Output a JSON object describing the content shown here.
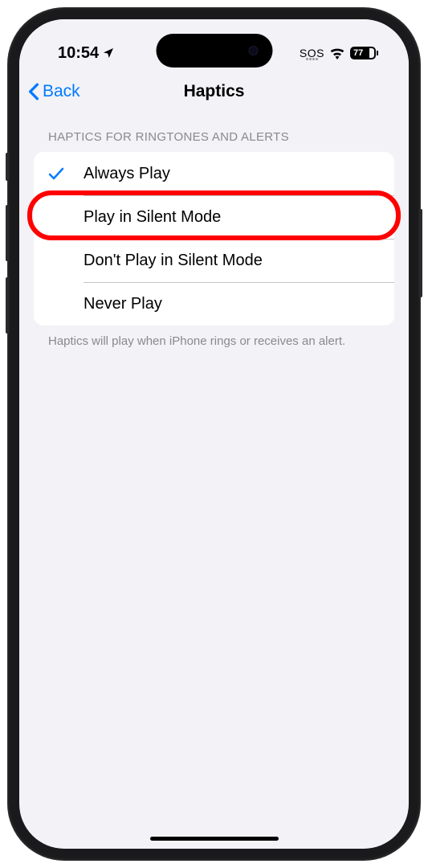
{
  "status_bar": {
    "time": "10:54",
    "sos": "SOS",
    "battery": "77"
  },
  "nav": {
    "back_label": "Back",
    "title": "Haptics"
  },
  "section": {
    "header": "HAPTICS FOR RINGTONES AND ALERTS",
    "footer": "Haptics will play when iPhone rings or receives an alert."
  },
  "options": [
    {
      "label": "Always Play",
      "selected": true
    },
    {
      "label": "Play in Silent Mode",
      "selected": false
    },
    {
      "label": "Don't Play in Silent Mode",
      "selected": false
    },
    {
      "label": "Never Play",
      "selected": false
    }
  ],
  "highlighted_index": 1
}
